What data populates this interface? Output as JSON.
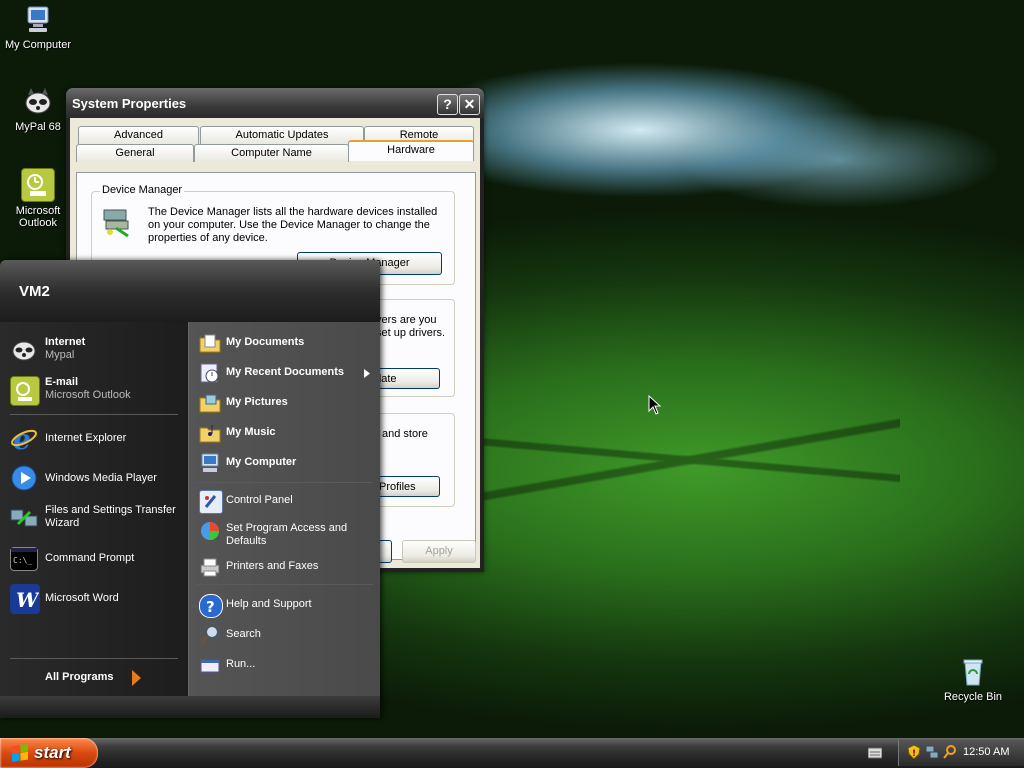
{
  "desktop": {
    "icons": [
      {
        "label": "My Computer"
      },
      {
        "label": "MyPal 68"
      },
      {
        "label": "Microsoft Outlook"
      },
      {
        "label": "Recycle Bin"
      }
    ]
  },
  "window": {
    "title": "System Properties",
    "help_btn": "?",
    "close_btn": "✕",
    "tabs_row1": [
      "Advanced",
      "Automatic Updates",
      "Remote"
    ],
    "tabs_row2": [
      "General",
      "Computer Name",
      "Hardware"
    ],
    "active_tab": "Hardware",
    "device_manager": {
      "group_title": "Device Manager",
      "description": "The Device Manager lists all the hardware devices installed on your computer. Use the Device Manager to change the properties of any device.",
      "button": "Device Manager"
    },
    "drivers_partial": {
      "text": "vers are you set up drivers.",
      "button": "pdate"
    },
    "profiles_partial": {
      "text": "and store",
      "button": "Profiles"
    },
    "apply_button": "Apply"
  },
  "start_menu": {
    "user": "VM2",
    "pinned": [
      {
        "label": "Internet",
        "sub": "Mypal"
      },
      {
        "label": "E-mail",
        "sub": "Microsoft Outlook"
      }
    ],
    "recent": [
      {
        "label": "Internet Explorer"
      },
      {
        "label": "Windows Media Player"
      },
      {
        "label": "Files and Settings Transfer Wizard"
      },
      {
        "label": "Command Prompt"
      },
      {
        "label": "Microsoft Word"
      }
    ],
    "all_programs": "All Programs",
    "right": [
      {
        "label": "My Documents"
      },
      {
        "label": "My Recent Documents"
      },
      {
        "label": "My Pictures"
      },
      {
        "label": "My Music"
      },
      {
        "label": "My Computer"
      },
      {
        "label": "Control Panel"
      },
      {
        "label": "Set Program Access and Defaults"
      },
      {
        "label": "Printers and Faxes"
      },
      {
        "label": "Help and Support"
      },
      {
        "label": "Search"
      },
      {
        "label": "Run..."
      }
    ]
  },
  "taskbar": {
    "start_label": "start",
    "clock": "12:50 AM"
  },
  "colors": {
    "start_button": "#d94a12",
    "tab_highlight": "#e6a32c",
    "menu_dark": "#252525"
  }
}
